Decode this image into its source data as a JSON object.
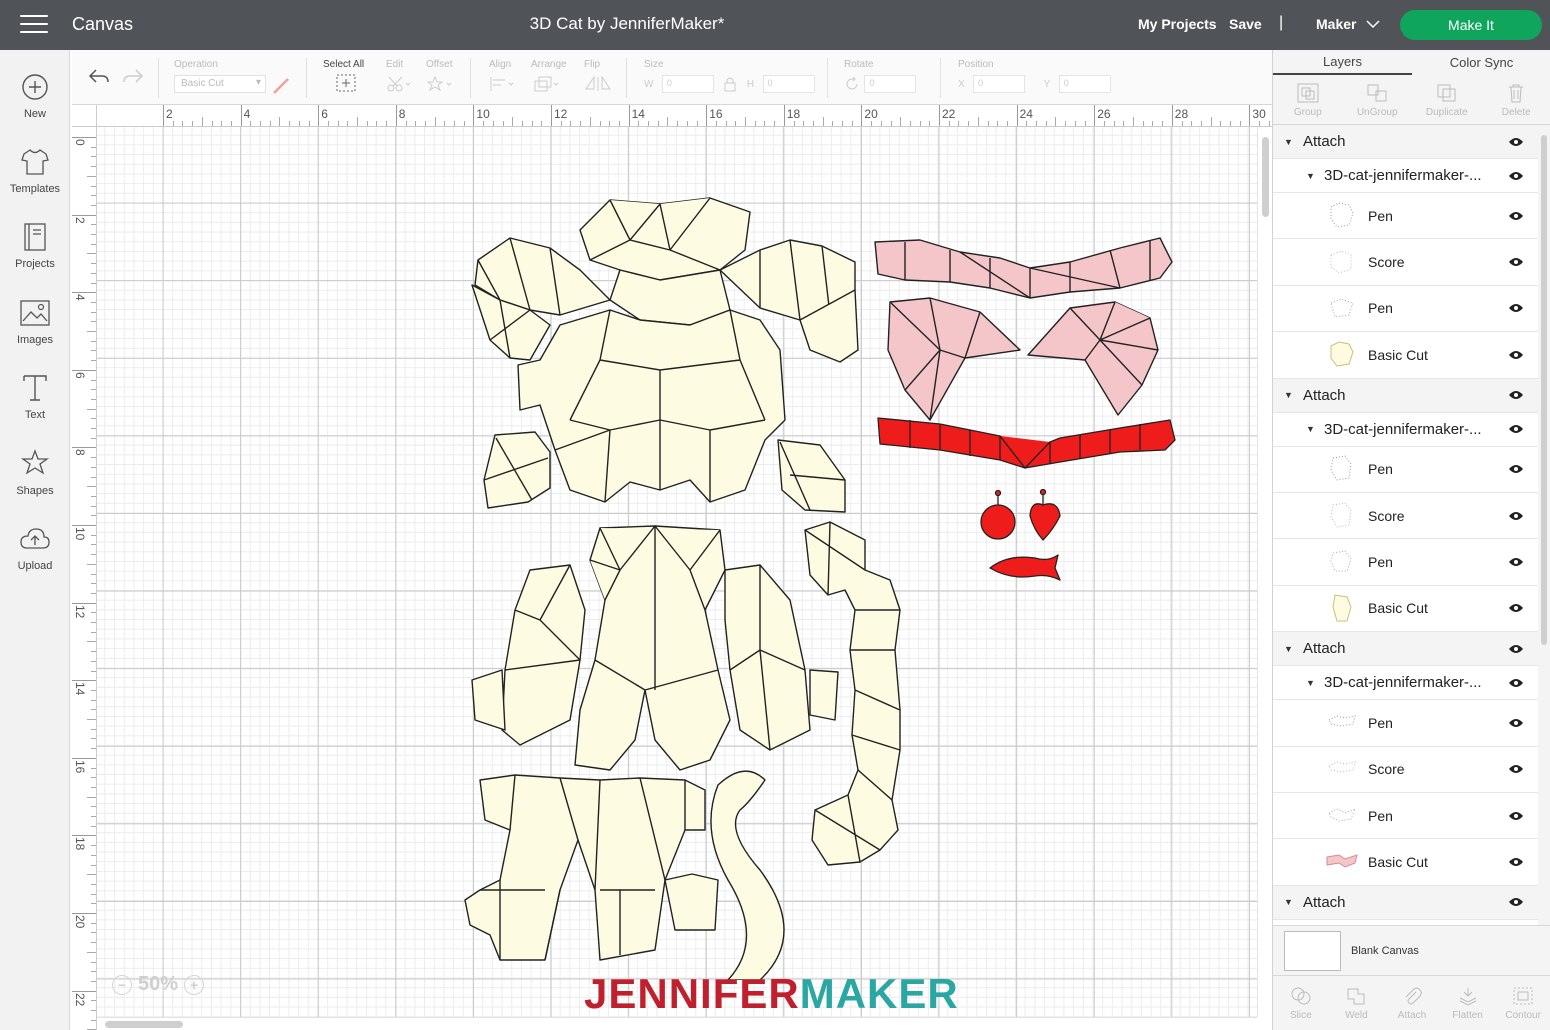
{
  "topbar": {
    "app_title": "Canvas",
    "project_title": "3D Cat by JenniferMaker*",
    "my_projects": "My Projects",
    "save": "Save",
    "separator": "|",
    "machine": "Maker",
    "make_it": "Make It"
  },
  "sidebar": {
    "items": [
      {
        "label": "New",
        "icon": "plus-circle-icon"
      },
      {
        "label": "Templates",
        "icon": "shirt-icon"
      },
      {
        "label": "Projects",
        "icon": "book-icon"
      },
      {
        "label": "Images",
        "icon": "image-icon"
      },
      {
        "label": "Text",
        "icon": "text-icon"
      },
      {
        "label": "Shapes",
        "icon": "shapes-icon"
      },
      {
        "label": "Upload",
        "icon": "cloud-upload-icon"
      }
    ]
  },
  "toolbar": {
    "operation_label": "Operation",
    "operation_value": "Basic Cut",
    "select_all_label": "Select All",
    "edit_label": "Edit",
    "offset_label": "Offset",
    "align_label": "Align",
    "arrange_label": "Arrange",
    "flip_label": "Flip",
    "size_label": "Size",
    "size_w": "W",
    "size_h": "H",
    "rotate_label": "Rotate",
    "position_label": "Position",
    "position_x": "X",
    "position_y": "Y",
    "field_value": "0"
  },
  "rulers": {
    "top": [
      "2",
      "4",
      "6",
      "8",
      "10",
      "12",
      "14",
      "16",
      "18",
      "20",
      "22",
      "24",
      "26",
      "28",
      "30"
    ],
    "left": [
      "0",
      "2",
      "4",
      "6",
      "8",
      "10",
      "12",
      "14",
      "16",
      "18",
      "20",
      "22"
    ]
  },
  "zoom": {
    "minus": "−",
    "value": "50%",
    "plus": "+"
  },
  "watermark": {
    "part1": "JENNIFER",
    "part2": "MAKER"
  },
  "right_panel": {
    "tabs": [
      "Layers",
      "Color Sync"
    ],
    "tools": [
      "Group",
      "UnGroup",
      "Duplicate",
      "Delete"
    ],
    "layers": [
      {
        "group": "Attach",
        "file": "3D-cat-jennifermaker-...",
        "items": [
          "Pen",
          "Score",
          "Pen",
          "Basic Cut"
        ],
        "thumb_color": "#fffbe0"
      },
      {
        "group": "Attach",
        "file": "3D-cat-jennifermaker-...",
        "items": [
          "Pen",
          "Score",
          "Pen",
          "Basic Cut"
        ],
        "thumb_color": "#fffbe0"
      },
      {
        "group": "Attach",
        "file": "3D-cat-jennifermaker-...",
        "items": [
          "Pen",
          "Score",
          "Pen",
          "Basic Cut"
        ],
        "thumb_color": "#f5c6c9"
      },
      {
        "group": "Attach"
      }
    ],
    "blank_canvas": "Blank Canvas",
    "bottom_tools": [
      "Slice",
      "Weld",
      "Attach",
      "Flatten",
      "Contour"
    ]
  },
  "colors": {
    "topbar": "#505458",
    "make_it": "#0fa55d",
    "cream": "#fdfbe1",
    "pink": "#f5c6c9",
    "red": "#ef1c1c"
  }
}
